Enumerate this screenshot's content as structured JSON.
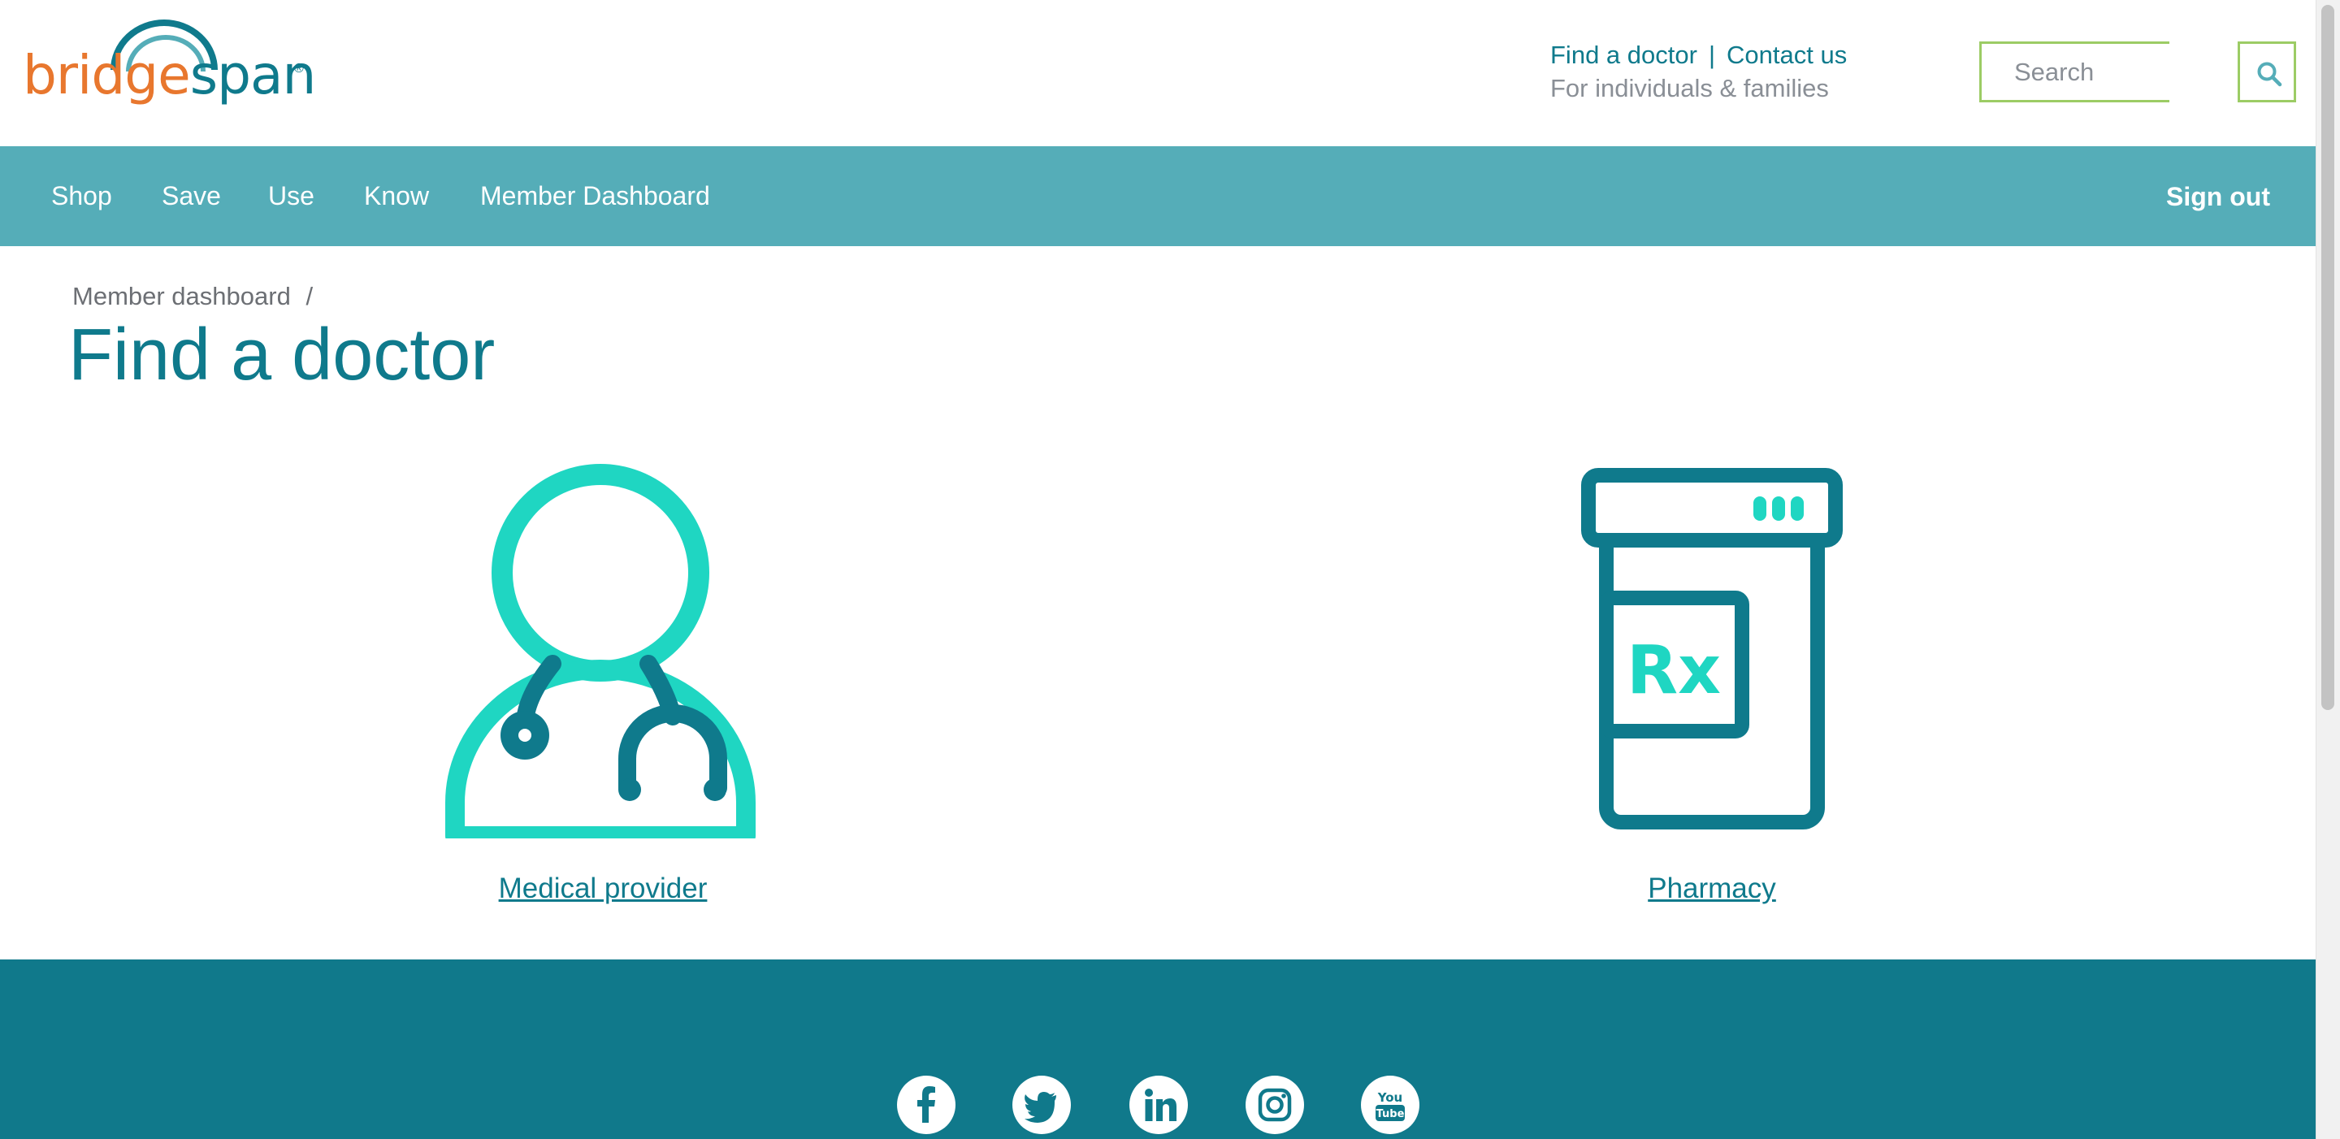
{
  "brand": {
    "logo_part1": "bridge",
    "logo_part2": "span",
    "logo_reg": "®",
    "color_orange": "#e8772e",
    "color_teal": "#0f7a8c"
  },
  "header": {
    "find_doctor": "Find a doctor",
    "separator": "|",
    "contact_us": "Contact us",
    "audience": "For individuals & families",
    "search_placeholder": "Search"
  },
  "nav": {
    "items": [
      "Shop",
      "Save",
      "Use",
      "Know",
      "Member Dashboard"
    ],
    "sign_out": "Sign out",
    "background": "#55adb8"
  },
  "breadcrumb": {
    "item": "Member dashboard",
    "separator": "/"
  },
  "page": {
    "title": "Find a doctor",
    "cards": [
      {
        "label": "Medical provider",
        "icon": "doctor-icon"
      },
      {
        "label": "Pharmacy",
        "icon": "pill-bottle-icon",
        "icon_text": "Rx"
      }
    ]
  },
  "footer": {
    "background": "#10798b",
    "social": [
      "facebook-icon",
      "twitter-icon",
      "linkedin-icon",
      "instagram-icon",
      "youtube-icon"
    ]
  }
}
